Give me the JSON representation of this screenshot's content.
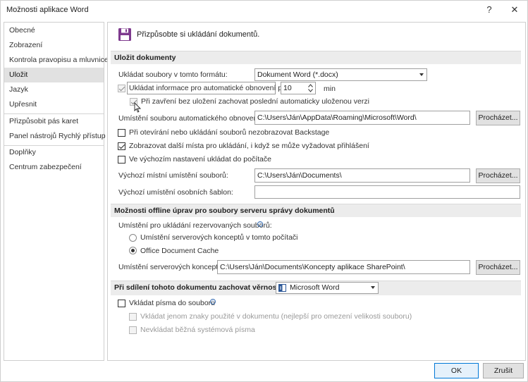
{
  "window": {
    "title": "Možnosti aplikace Word",
    "help_glyph": "?",
    "close_glyph": "✕"
  },
  "sidebar": {
    "items": [
      {
        "label": "Obecné"
      },
      {
        "label": "Zobrazení"
      },
      {
        "label": "Kontrola pravopisu a mluvnice"
      },
      {
        "label": "Uložit"
      },
      {
        "label": "Jazyk"
      },
      {
        "label": "Upřesnit"
      },
      {
        "label": "Přizpůsobit pás karet"
      },
      {
        "label": "Panel nástrojů Rychlý přístup"
      },
      {
        "label": "Doplňky"
      },
      {
        "label": "Centrum zabezpečení"
      }
    ],
    "active_index": 3
  },
  "main": {
    "header_title": "Přizpůsobte si ukládání dokumentů.",
    "save_section": {
      "title": "Uložit dokumenty",
      "format_label": "Ukládat soubory v tomto formátu:",
      "format_value": "Dokument Word (*.docx)",
      "autorecover_label": "Ukládat informace pro automatické obnovení po",
      "autorecover_checked": true,
      "autorecover_minutes": "10",
      "minutes_unit": "min",
      "keep_last_label": "Při zavření bez uložení zachovat poslední automaticky uloženou verzi",
      "keep_last_checked": true,
      "autorecover_location_label": "Umístění souboru automatického obnovení:",
      "autorecover_location_value": "C:\\Users\\Ján\\AppData\\Roaming\\Microsoft\\Word\\",
      "browse_label": "Procházet...",
      "no_backstage_label": "Při otevírání nebo ukládání souborů nezobrazovat Backstage",
      "no_backstage_checked": false,
      "show_additional_label": "Zobrazovat další místa pro ukládání, i když se může vyžadovat přihlášení",
      "show_additional_checked": true,
      "save_to_computer_label": "Ve výchozím nastavení ukládat do počítače",
      "save_to_computer_checked": false,
      "default_local_label": "Výchozí místní umístění souborů:",
      "default_local_value": "C:\\Users\\Ján\\Documents\\",
      "personal_templates_label": "Výchozí umístění osobních šablon:",
      "personal_templates_value": ""
    },
    "offline_section": {
      "title": "Možnosti offline úprav pro soubory serveru správy dokumentů",
      "checked_out_label": "Umístění pro ukládání rezervovaných souborů:",
      "radio_server_drafts": "Umístění serverových konceptů v tomto počítači",
      "radio_office_cache": "Office Document Cache",
      "selected": "office_cache",
      "server_drafts_label": "Umístění serverových konceptů:",
      "server_drafts_value": "C:\\Users\\Ján\\Documents\\Koncepty aplikace SharePoint\\"
    },
    "fidelity_section": {
      "title": "Při sdílení tohoto dokumentu zachovat věrnost:",
      "document_value": "Microsoft Word",
      "embed_fonts_label": "Vkládat písma do souboru",
      "embed_fonts_checked": false,
      "embed_used_chars_label": "Vkládat jenom znaky použité v dokumentu (nejlepší pro omezení velikosti souboru)",
      "no_common_fonts_label": "Nevkládat běžná systémová písma"
    }
  },
  "footer": {
    "ok_label": "OK",
    "cancel_label": "Zrušit"
  }
}
